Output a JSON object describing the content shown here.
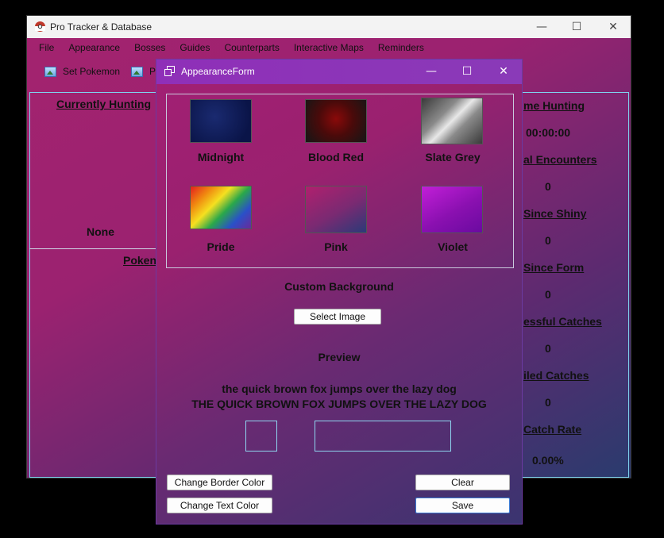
{
  "main_window": {
    "title": "Pro Tracker & Database",
    "controls": {
      "minimize": "—",
      "maximize": "☐",
      "close": "✕"
    },
    "menu": [
      "File",
      "Appearance",
      "Bosses",
      "Guides",
      "Counterparts",
      "Interactive Maps",
      "Reminders"
    ],
    "toolbar": [
      "Set Pokemon",
      "P"
    ],
    "left": {
      "currently_hunting": "Currently Hunting",
      "none": "None",
      "pokemon": "Poken"
    },
    "right": {
      "time_hunting_label": "me Hunting",
      "time_hunting_value": "00:00:00",
      "total_encounters_label": "al Encounters",
      "total_encounters_value": "0",
      "since_shiny_label": "Since Shiny",
      "since_shiny_value": "0",
      "since_form_label": "Since Form",
      "since_form_value": "0",
      "successful_catches_label": "essful Catches",
      "successful_catches_value": "0",
      "failed_catches_label": "iled Catches",
      "failed_catches_value": "0",
      "catch_rate_label": "Catch Rate",
      "catch_rate_value": "0.00%"
    }
  },
  "dialog": {
    "title": "AppearanceForm",
    "controls": {
      "minimize": "—",
      "maximize": "☐",
      "close": "✕"
    },
    "swatches": [
      {
        "label": "Midnight"
      },
      {
        "label": "Blood Red"
      },
      {
        "label": "Slate Grey"
      },
      {
        "label": "Pride"
      },
      {
        "label": "Pink"
      },
      {
        "label": "Violet"
      }
    ],
    "custom_background": "Custom Background",
    "select_image": "Select Image",
    "preview": "Preview",
    "preview_lower": "the quick brown fox jumps over the lazy dog",
    "preview_upper": "THE QUICK BROWN FOX JUMPS OVER THE LAZY DOG",
    "change_border_color": "Change Border Color",
    "change_text_color": "Change Text Color",
    "clear": "Clear",
    "save": "Save"
  },
  "colors": {
    "panel_border": "#7fd4f0",
    "dialog_title": "#8f2fb8"
  }
}
